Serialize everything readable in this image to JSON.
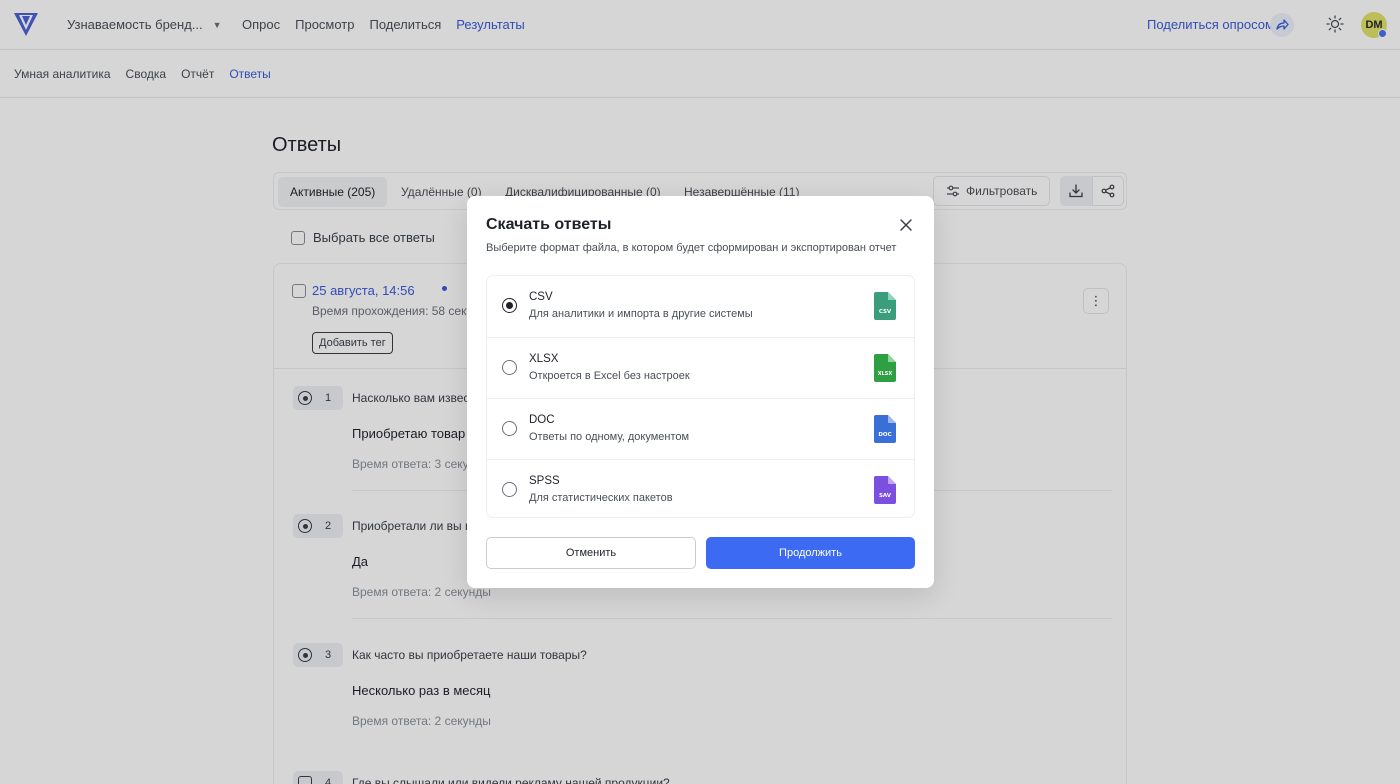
{
  "header": {
    "survey_name": "Узнаваемость бренд...",
    "nav": [
      "Опрос",
      "Просмотр",
      "Поделиться",
      "Результаты"
    ],
    "active_nav": "Результаты",
    "share_link": "Поделиться опросом",
    "avatar_initials": "DM"
  },
  "subnav": {
    "items": [
      "Умная аналитика",
      "Сводка",
      "Отчёт",
      "Ответы"
    ],
    "active": "Ответы"
  },
  "page": {
    "title": "Ответы",
    "tabs": [
      {
        "label": "Активные  (205)",
        "active": true
      },
      {
        "label": "Удалённые  (0)",
        "active": false
      },
      {
        "label": "Дисквалифицированные  (0)",
        "active": false
      },
      {
        "label": "Незавершённые  (11)",
        "active": false
      }
    ],
    "filter_label": "Фильтровать",
    "select_all_label": "Выбрать все ответы"
  },
  "response": {
    "date": "25 августа, 14:56",
    "duration": "Время прохождения: 58 секу",
    "add_tag": "Добавить тег",
    "questions": [
      {
        "num": "1",
        "text": "Насколько вам извест",
        "answer": "Приобретаю товар",
        "time": "Время ответа: 3 секун"
      },
      {
        "num": "2",
        "text": "Приобретали ли вы на",
        "answer": "Да",
        "time": "Время ответа: 2 секунды"
      },
      {
        "num": "3",
        "text": "Как часто вы приобретаете наши товары?",
        "answer": "Несколько раз в месяц",
        "time": "Время ответа: 2 секунды"
      },
      {
        "num": "4",
        "text": "Где вы слышали или видели рекламу нашей продукции?",
        "answer": "",
        "time": ""
      }
    ]
  },
  "modal": {
    "title": "Скачать ответы",
    "subtitle": "Выберите формат файла, в котором будет сформирован и экспортирован отчет",
    "options": [
      {
        "name": "CSV",
        "desc": "Для аналитики и импорта в другие системы",
        "icon_label": "CSV",
        "color": "#3a9d7c",
        "selected": true
      },
      {
        "name": "XLSX",
        "desc": "Откроется в Excel без настроек",
        "icon_label": "XLSX",
        "color": "#2ea043",
        "selected": false
      },
      {
        "name": "DOC",
        "desc": "Ответы по одному, документом",
        "icon_label": "DOC",
        "color": "#3b6fd8",
        "selected": false
      },
      {
        "name": "SPSS",
        "desc": "Для статистических пакетов",
        "icon_label": "SAV",
        "color": "#7b4fe0",
        "selected": false
      }
    ],
    "cancel_label": "Отменить",
    "continue_label": "Продолжить"
  },
  "colors": {
    "accent": "#3b5bdb",
    "primary_button": "#3d6af2"
  }
}
